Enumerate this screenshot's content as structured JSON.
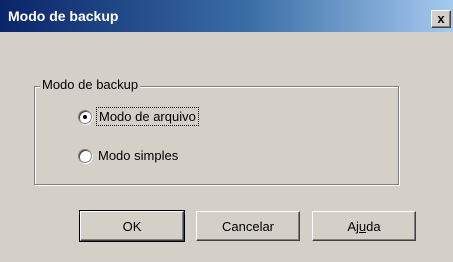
{
  "window": {
    "title": "Modo de backup",
    "close_glyph": "x"
  },
  "group": {
    "label": "Modo de backup",
    "options": [
      {
        "label": "Modo de arquivo",
        "checked": true
      },
      {
        "label": "Modo simples",
        "checked": false
      }
    ]
  },
  "buttons": {
    "ok": "OK",
    "cancel": "Cancelar",
    "help_prefix": "Aj",
    "help_mnemonic": "u",
    "help_suffix": "da"
  },
  "icons": {
    "close": "close-icon"
  }
}
